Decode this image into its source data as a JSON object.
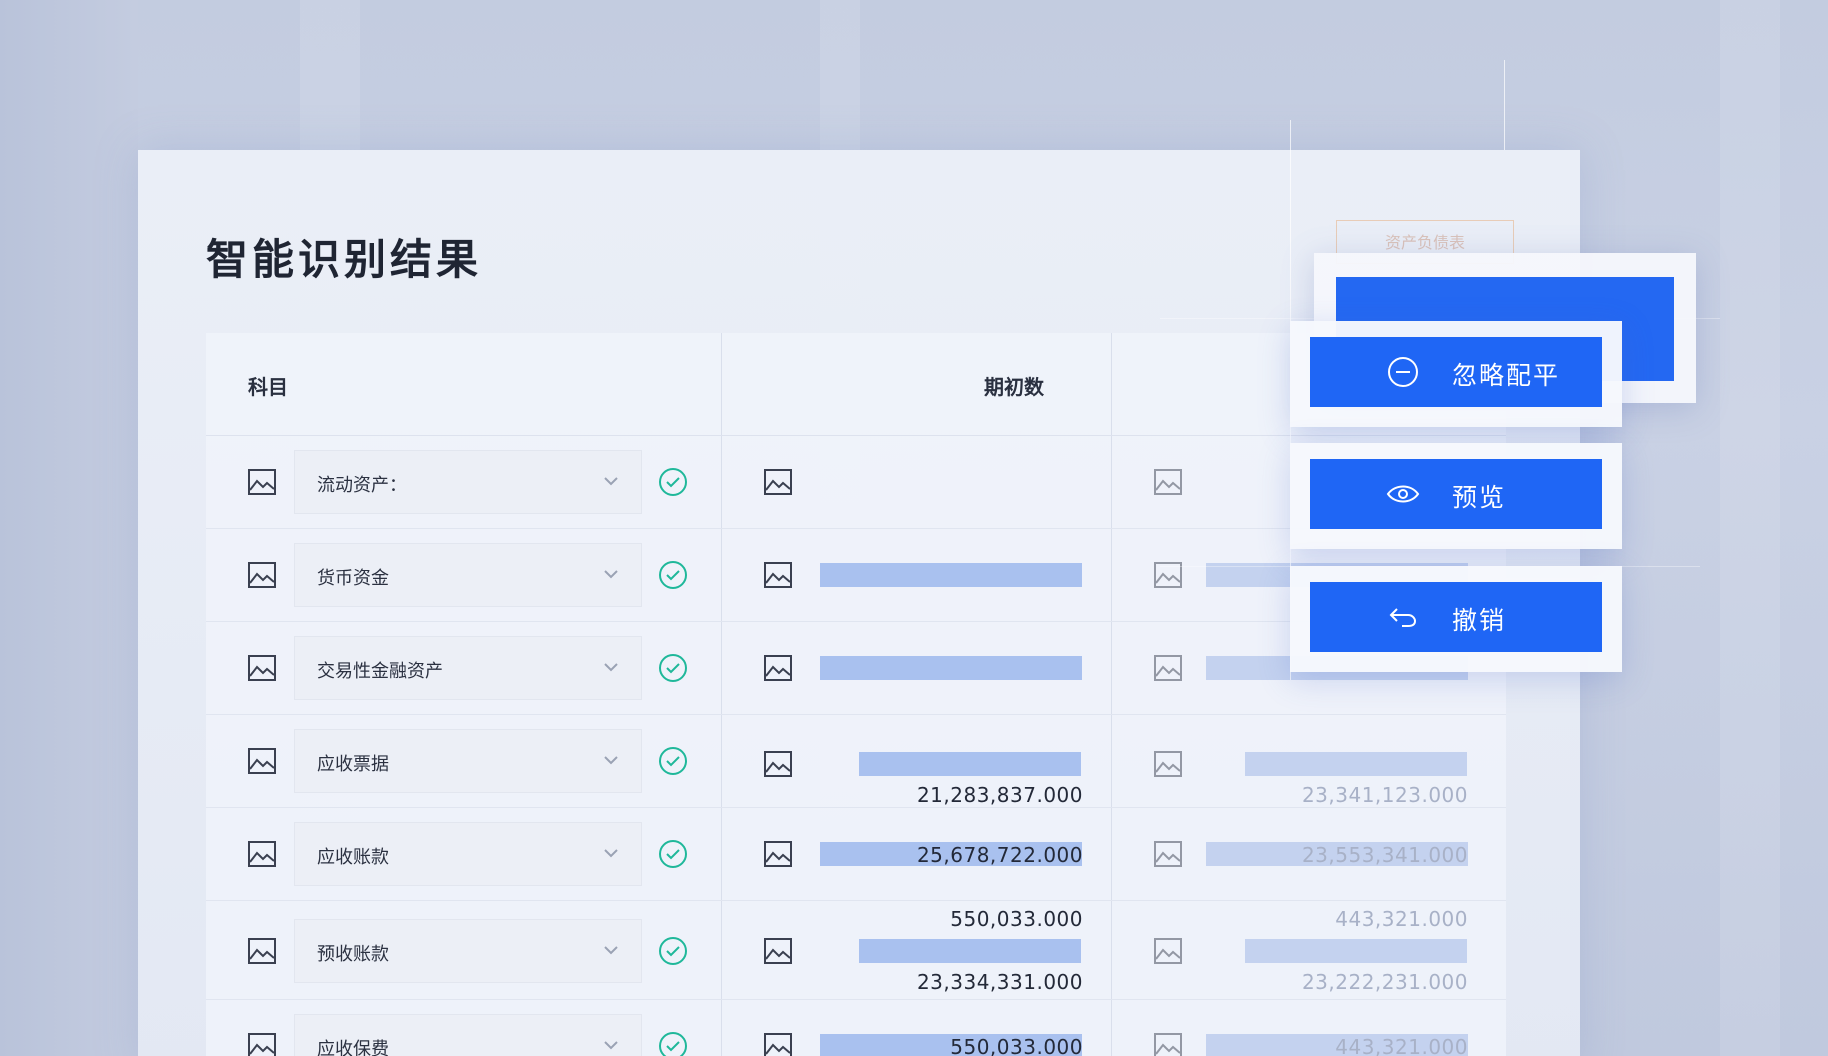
{
  "title": "智能识别结果",
  "ghost_tag": "资产负债表",
  "table": {
    "headers": {
      "subject": "科目",
      "opening": "期初数"
    },
    "rows": [
      {
        "label": "流动资产：",
        "opening_values": [],
        "closing_values": []
      },
      {
        "label": "货币资金",
        "opening_values": [],
        "closing_values": []
      },
      {
        "label": "交易性金融资产",
        "opening_values": [],
        "closing_values": []
      },
      {
        "label": "应收票据",
        "opening_values": [
          "21,283,837.000"
        ],
        "closing_values": [
          "23,341,123.000"
        ]
      },
      {
        "label": "应收账款",
        "opening_values": [
          "25,678,722.000"
        ],
        "closing_values": [
          "23,553,341.000"
        ]
      },
      {
        "label": "预收账款",
        "opening_values": [
          "550,033.000",
          "23,334,331.000"
        ],
        "closing_values": [
          "443,321.000",
          "23,222,231.000"
        ]
      },
      {
        "label": "应收保费",
        "opening_values": [
          "550,033.000"
        ],
        "closing_values": [
          "443,321.000"
        ]
      }
    ]
  },
  "menu": {
    "ignore_balance": "忽略配平",
    "preview": "预览",
    "undo": "撤销"
  },
  "icons": {
    "row_image": "image-icon",
    "dropdown": "chevron-down-icon",
    "status": "check-circle-icon",
    "ignore": "minus-circle-icon",
    "preview": "eye-icon",
    "undo": "undo-arrow-icon"
  },
  "colors": {
    "primary": "#1f66f5",
    "check": "#1fb89a",
    "highlight": "#a9c1ef"
  }
}
